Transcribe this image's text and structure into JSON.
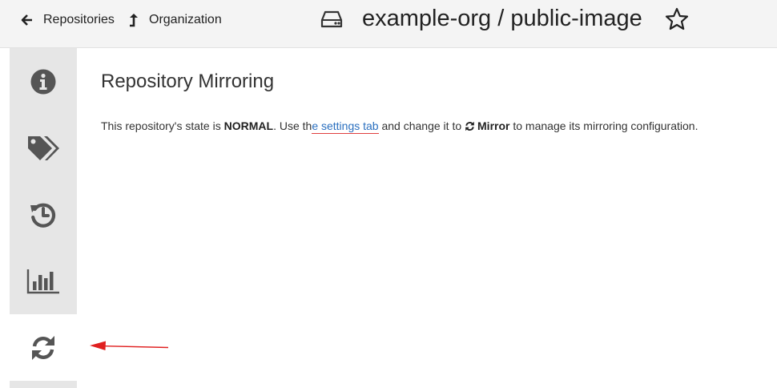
{
  "header": {
    "back_label": "Repositories",
    "up_label": "Organization",
    "repo_path": "example-org / public-image"
  },
  "sidebar": {
    "items": [
      {
        "icon": "info-icon"
      },
      {
        "icon": "tags-icon"
      },
      {
        "icon": "history-icon"
      },
      {
        "icon": "bar-chart-icon"
      },
      {
        "icon": "refresh-icon",
        "active": true
      }
    ]
  },
  "main": {
    "title": "Repository Mirroring",
    "state_prefix": "This repository's state is ",
    "state_value": "NORMAL",
    "use_text": ". Use th",
    "link_text": "e settings tab",
    "middle_text": " and change it to ",
    "mirror_label": "Mirror",
    "suffix_text": " to manage its mirroring configuration."
  },
  "colors": {
    "link": "#2a6fbf",
    "annotation_arrow": "#e02020",
    "sidebar_bg": "#e6e6e6",
    "icon": "#555555"
  }
}
